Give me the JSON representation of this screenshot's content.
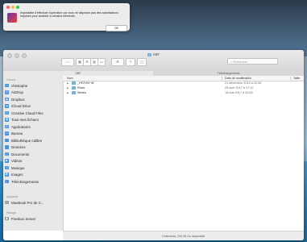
{
  "alert": {
    "message": "Impossible d'effectuer l'opération car vous ne disposez pas des autorisations requises pour accéder à certains éléments.",
    "ok_label": "OK"
  },
  "window": {
    "title": "SBF",
    "search_placeholder": "Rechercher",
    "tabs": [
      "SBF",
      "Téléchargements"
    ]
  },
  "sidebar": {
    "favorites_heading": "Favoris",
    "favorites": [
      {
        "label": "christophe",
        "icon": "home-icon"
      },
      {
        "label": "AirDrop",
        "icon": "airdrop-icon"
      },
      {
        "label": "Dropbox",
        "icon": "dropbox-icon"
      },
      {
        "label": "iCloud Drive",
        "icon": "cloud-icon"
      },
      {
        "label": "Creative Cloud Files",
        "icon": "creative-cloud-icon"
      },
      {
        "label": "Tous mes fichiers",
        "icon": "all-files-icon"
      },
      {
        "label": "Applications",
        "icon": "applications-icon"
      },
      {
        "label": "Bureau",
        "icon": "desktop-icon"
      },
      {
        "label": "Bibliothèque calibre",
        "icon": "folder-icon"
      },
      {
        "label": "Données",
        "icon": "folder-icon"
      },
      {
        "label": "Documents",
        "icon": "documents-icon"
      },
      {
        "label": "Vidéos",
        "icon": "movies-icon"
      },
      {
        "label": "Musique",
        "icon": "music-icon"
      },
      {
        "label": "Images",
        "icon": "pictures-icon"
      },
      {
        "label": "Téléchargements",
        "icon": "downloads-icon"
      }
    ],
    "devices_heading": "Appareils",
    "devices": [
      {
        "label": "MacBook Pro de C...",
        "icon": "laptop-icon"
      }
    ],
    "shared_heading": "Partagé",
    "shared": [
      {
        "label": "Freebox Server",
        "icon": "server-icon"
      }
    ]
  },
  "list": {
    "col_name": "Nom",
    "col_date": "Date de modification",
    "col_size": "Taille",
    "rows": [
      {
        "name": "_HFZVN~W",
        "date": "21 décembre 2013 à 22:06"
      },
      {
        "name": "Films",
        "date": "29 avril 2017 à 17:12"
      },
      {
        "name": "Séries",
        "date": "18 mai 2017 à 20:45"
      }
    ]
  },
  "status": "3 éléments, 290,06 Go disponible"
}
